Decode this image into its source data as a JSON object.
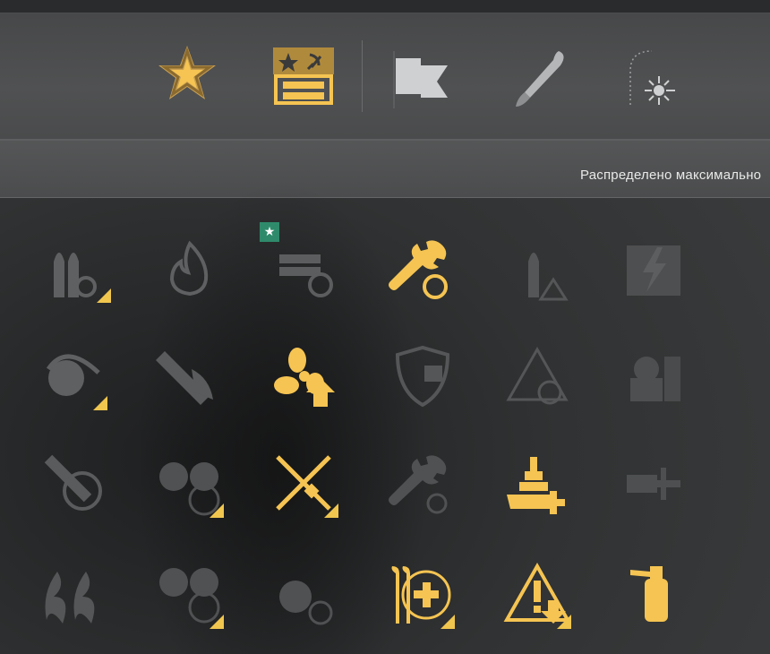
{
  "window": {
    "title": ""
  },
  "info_bar": {
    "text": "Распределено максимально"
  },
  "colors": {
    "active": "#f5c452",
    "inactive": "#6b6c6d",
    "badge": "#2f8a6b",
    "corner": "#f0c64e"
  },
  "top_tabs": [
    {
      "id": "commander-rank",
      "icon": "star-medal-icon",
      "active": true
    },
    {
      "id": "faction-banner",
      "icon": "soviet-emblem-icon",
      "active": true
    },
    {
      "id": "flags",
      "icon": "flag-icon",
      "active": false
    },
    {
      "id": "camouflage",
      "icon": "brush-icon",
      "active": false
    },
    {
      "id": "signals",
      "icon": "flare-icon",
      "active": false
    }
  ],
  "skills": [
    {
      "name": "shells-reload",
      "state": "inactive",
      "corner": true
    },
    {
      "name": "fire-prevention",
      "state": "inactive",
      "corner": false
    },
    {
      "name": "torpedo-reload",
      "state": "inactive",
      "corner": false,
      "badge": "★"
    },
    {
      "name": "repair-reload",
      "state": "active",
      "corner": false
    },
    {
      "name": "shell-warning",
      "state": "inactive",
      "corner": false
    },
    {
      "name": "lightning-armor",
      "state": "inactive",
      "corner": false
    },
    {
      "name": "turret-traverse",
      "state": "inactive",
      "corner": true
    },
    {
      "name": "fire-bomb",
      "state": "inactive",
      "corner": false
    },
    {
      "name": "propulsion-boost",
      "state": "active",
      "corner": false
    },
    {
      "name": "spotting-shield",
      "state": "inactive",
      "corner": false
    },
    {
      "name": "priority-target",
      "state": "inactive",
      "corner": false
    },
    {
      "name": "armament-crates",
      "state": "inactive",
      "corner": false
    },
    {
      "name": "aa-rockets",
      "state": "inactive",
      "corner": false
    },
    {
      "name": "aa-guns",
      "state": "inactive",
      "corner": true
    },
    {
      "name": "crossed-weapons",
      "state": "active",
      "corner": true
    },
    {
      "name": "repair-timer",
      "state": "inactive",
      "corner": false
    },
    {
      "name": "ship-health-plus",
      "state": "active",
      "corner": false
    },
    {
      "name": "secondary-guns",
      "state": "inactive",
      "corner": false
    },
    {
      "name": "fire-claw",
      "state": "inactive",
      "corner": false
    },
    {
      "name": "aa-targeting",
      "state": "inactive",
      "corner": true
    },
    {
      "name": "turret-reload",
      "state": "inactive",
      "corner": false
    },
    {
      "name": "tools-heal",
      "state": "active",
      "corner": true
    },
    {
      "name": "warning-down",
      "state": "active",
      "corner": true
    },
    {
      "name": "extinguisher",
      "state": "active",
      "corner": false
    }
  ]
}
